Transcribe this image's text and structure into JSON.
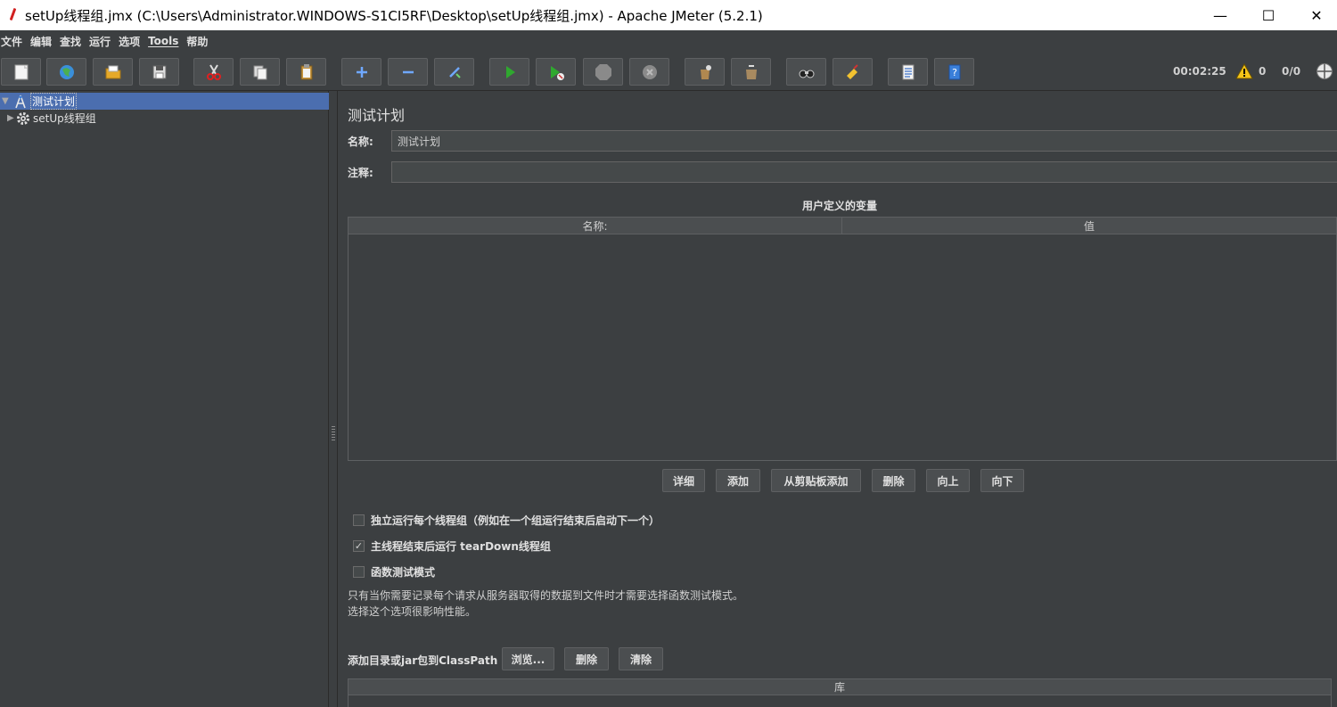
{
  "window": {
    "title": "setUp线程组.jmx (C:\\Users\\Administrator.WINDOWS-S1CI5RF\\Desktop\\setUp线程组.jmx) - Apache JMeter (5.2.1)",
    "minimize": "—",
    "maximize": "☐",
    "close": "✕"
  },
  "menu": [
    "文件",
    "编辑",
    "查找",
    "运行",
    "选项",
    "Tools",
    "帮助"
  ],
  "toolbar": {
    "icons": [
      "new-icon",
      "templates-icon",
      "open-icon",
      "save-icon",
      "cut-icon",
      "copy-icon",
      "paste-icon",
      "expand-icon",
      "collapse-icon",
      "toggle-icon",
      "start-icon",
      "start-no-pauses-icon",
      "stop-icon",
      "shutdown-icon",
      "clear-icon",
      "clear-all-icon",
      "search-icon",
      "reset-search-icon",
      "function-helper-icon",
      "help-icon"
    ],
    "timer": "00:02:25",
    "warnings": "0",
    "threads": "0/0"
  },
  "tree": {
    "items": [
      {
        "label": "测试计划",
        "icon": "test-plan-icon",
        "expanded": true,
        "selected": true
      },
      {
        "label": "setUp线程组",
        "icon": "gear-icon",
        "expanded": false,
        "selected": false
      }
    ]
  },
  "panel": {
    "title": "测试计划",
    "name_label": "名称:",
    "name_value": "测试计划",
    "comment_label": "注释:",
    "comment_value": "",
    "vars_title": "用户定义的变量",
    "vars_columns": [
      "名称:",
      "值"
    ],
    "buttons": [
      "详细",
      "添加",
      "从剪贴板添加",
      "删除",
      "向上",
      "向下"
    ],
    "options": [
      {
        "label": "独立运行每个线程组（例如在一个组运行结束后启动下一个）",
        "checked": false
      },
      {
        "label": "主线程结束后运行 tearDown线程组",
        "checked": true
      },
      {
        "label": "函数测试模式",
        "checked": false
      }
    ],
    "note_line1": "只有当你需要记录每个请求从服务器取得的数据到文件时才需要选择函数测试模式。",
    "note_line2": "选择这个选项很影响性能。",
    "classpath_label": "添加目录或jar包到ClassPath",
    "classpath_buttons": [
      "浏览...",
      "删除",
      "清除"
    ],
    "lib_column": "库"
  },
  "colors": {
    "background": "#3c3f41",
    "selection": "#4b6eaf",
    "start_green": "#2fa82f"
  }
}
